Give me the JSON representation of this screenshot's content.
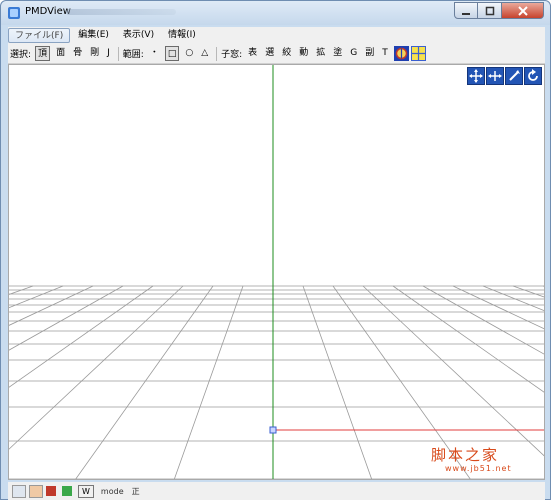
{
  "window": {
    "title": "PMDView"
  },
  "menu": [
    {
      "label": "ファイル(F)",
      "active": true
    },
    {
      "label": "編集(E)"
    },
    {
      "label": "表示(V)"
    },
    {
      "label": "情報(I)"
    }
  ],
  "toolbar": {
    "select_label": "選択:",
    "select_items": [
      "頂",
      "面",
      "骨",
      "剛",
      "J"
    ],
    "select_pressed": "頂",
    "range_label": "範囲:",
    "range_items": [
      "・",
      "□",
      "○",
      "△"
    ],
    "range_pressed": "□",
    "window_label": "子窓:",
    "window_items": [
      "表",
      "選",
      "絞",
      "動",
      "拡",
      "塗",
      "G",
      "副",
      "T"
    ]
  },
  "statusbar": {
    "mode_label": "mode",
    "last_text": "正"
  },
  "watermark": {
    "main": "脚本之家",
    "sub": "www.jb51.net"
  },
  "colors": {
    "grid": "#9a9a9a",
    "y_axis": "#1e8c1e",
    "x_axis": "#e23c3c",
    "origin": "#3a5fd0",
    "nav_icon_bg": "#2355b5"
  }
}
